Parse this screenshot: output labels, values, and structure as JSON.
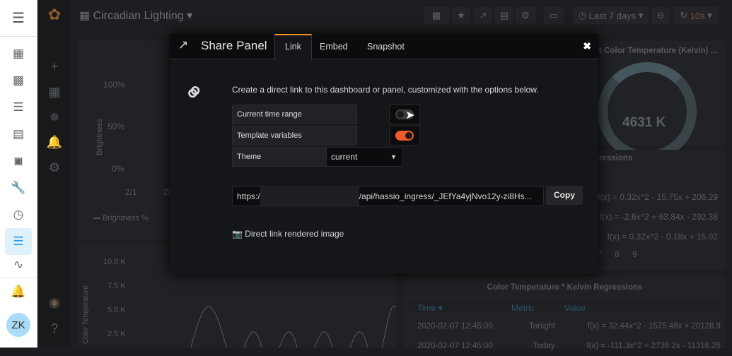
{
  "ha_sidebar": {
    "icons": [
      "menu-icon",
      "apps-icon",
      "account-box-icon",
      "list-icon",
      "chart-box-icon",
      "c-box-icon",
      "wrench-icon",
      "speedometer-icon",
      "timeline-icon",
      "chart-line-icon",
      "bell-icon"
    ],
    "user_initials": "ZK",
    "active_color": "#1e9be8"
  },
  "dashboard": {
    "title": "Circadian Lighting",
    "time_range": "Last 7 days",
    "refresh": "10s",
    "refresh_color": "#b86b2e"
  },
  "panels": {
    "brightness": {
      "y_label": "Brightness",
      "ticks": [
        "100%",
        "50%",
        "0%"
      ],
      "x_ticks": [
        "2/1",
        "2/"
      ],
      "legend": "Brightness %"
    },
    "color_temp_chart": {
      "y_label": "Color Temperature",
      "ticks": [
        "10.0 K",
        "7.5 K",
        "5.0 K",
        "2.5 K"
      ]
    },
    "gauge": {
      "title": "nt Color Temperature (Kelvin) ...",
      "value": "4631 K"
    },
    "regressions": {
      "title": "ressions",
      "rows": [
        "f(x) = 0.32x^2 - 15.75x + 206.29",
        "f(x) = -2.6x^2 + 63.84x - 292.38",
        "f(x) = 0.32x^2 - 0.18x + 15.02"
      ],
      "pager": [
        "7",
        "8",
        "9"
      ]
    },
    "kelvin_table": {
      "title": "Color Temperature * Kelvin Regressions",
      "headers": [
        "Time",
        "Metric",
        "Value"
      ],
      "rows": [
        [
          "2020-02-07 12:45:00",
          "Tonight",
          "f(x) = 32.44x^2 - 1575.48x + 20128.9"
        ],
        [
          "2020-02-07 12:45:00",
          "Today",
          "f(x) = -111.3x^2 + 2736.2x - 11316.25"
        ]
      ]
    }
  },
  "modal": {
    "title": "Share Panel",
    "tabs": [
      "Link",
      "Embed",
      "Snapshot"
    ],
    "active_tab": "Link",
    "description": "Create a direct link to this dashboard or panel, customized with the options below.",
    "options": [
      {
        "label": "Current time range",
        "enabled": false
      },
      {
        "label": "Template variables",
        "enabled": true
      }
    ],
    "theme_label": "Theme",
    "theme_value": "current",
    "url_prefix": "https:/",
    "url_suffix": "/api/hassio_ingress/_JEfYa4yjNvo12y-zi8Hs...",
    "copy_label": "Copy",
    "rendered_image_label": "Direct link rendered image",
    "accent": "#f05a28"
  }
}
